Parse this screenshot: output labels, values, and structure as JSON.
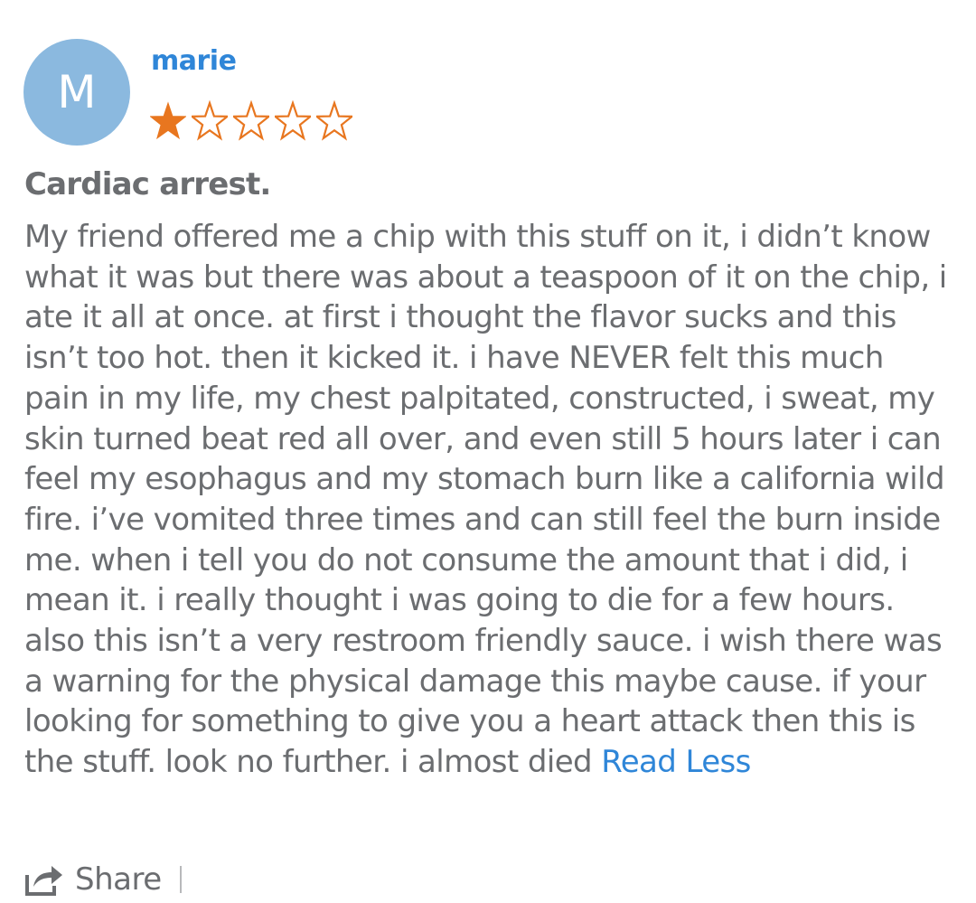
{
  "reviewer": {
    "initial": "M",
    "name": "marie",
    "avatar_color": "#8bb9df"
  },
  "rating": {
    "value": 1,
    "max": 5,
    "star_color": "#e8761f"
  },
  "review": {
    "title": "Cardiac arrest.",
    "body": "My friend offered me a chip with this stuff on it, i didn’t know what it was but there was about a teaspoon of it on the chip, i ate it all at once. at first i thought the flavor sucks and this isn’t too hot. then it kicked it. i have NEVER felt this much pain in my life, my chest palpitated, constructed, i sweat, my skin turned beat red all over, and even still 5 hours later i can feel my esophagus and my stomach burn like a california wild fire. i’ve vomited three times and can still feel the burn inside me. when i tell you do not consume the amount that i did, i mean it. i really thought i was going to die for a few hours. also this isn’t a very restroom friendly sauce. i wish there was a warning for the physical damage this maybe cause. if your looking for something to give you a heart attack then this is the stuff. look no further. i almost died",
    "read_less_label": "Read Less"
  },
  "actions": {
    "share_label": "Share",
    "share_icon": "share-arrow-icon"
  },
  "colors": {
    "link": "#2f86d8",
    "text": "#6b6d70"
  }
}
